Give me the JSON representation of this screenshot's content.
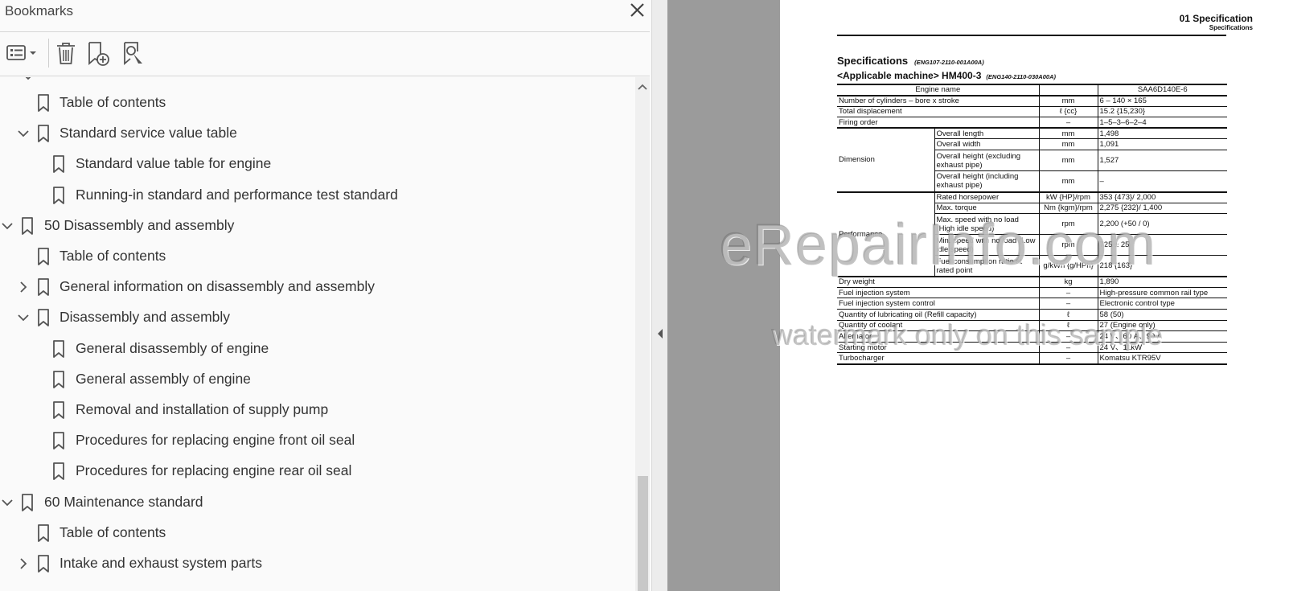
{
  "panel": {
    "title": "Bookmarks",
    "close_icon": "close-icon",
    "toolbar": [
      {
        "name": "options-menu-button",
        "icon": "list-options-icon"
      },
      {
        "name": "delete-bookmark-button",
        "icon": "trash-icon"
      },
      {
        "name": "new-bookmark-button",
        "icon": "bookmark-add-icon"
      },
      {
        "name": "find-bookmark-button",
        "icon": "bookmark-search-icon"
      }
    ]
  },
  "bookmarks": [
    {
      "level": 1,
      "chevron": "none",
      "label": "Table of contents"
    },
    {
      "level": 1,
      "chevron": "expanded",
      "label": "Standard service value table"
    },
    {
      "level": 2,
      "chevron": "none",
      "label": "Standard value table for engine"
    },
    {
      "level": 2,
      "chevron": "none",
      "label": "Running-in standard and performance test standard"
    },
    {
      "level": 0,
      "chevron": "expanded",
      "label": "50 Disassembly and assembly"
    },
    {
      "level": 1,
      "chevron": "none",
      "label": "Table of contents"
    },
    {
      "level": 1,
      "chevron": "collapsed",
      "label": "General information on disassembly and assembly"
    },
    {
      "level": 1,
      "chevron": "expanded",
      "label": "Disassembly and assembly"
    },
    {
      "level": 2,
      "chevron": "none",
      "label": "General disassembly of engine"
    },
    {
      "level": 2,
      "chevron": "none",
      "label": "General assembly of engine"
    },
    {
      "level": 2,
      "chevron": "none",
      "label": "Removal and installation of supply pump"
    },
    {
      "level": 2,
      "chevron": "none",
      "label": "Procedures for replacing engine front oil seal"
    },
    {
      "level": 2,
      "chevron": "none",
      "label": "Procedures for replacing engine rear oil seal"
    },
    {
      "level": 0,
      "chevron": "expanded",
      "label": "60 Maintenance standard"
    },
    {
      "level": 1,
      "chevron": "none",
      "label": "Table of contents"
    },
    {
      "level": 1,
      "chevron": "collapsed",
      "label": "Intake and exhaust system parts"
    }
  ],
  "document": {
    "header_title": "01 Specification",
    "header_subtitle": "Specifications",
    "section_title": "Specifications",
    "section_code": "(ENG107-2110-001A00A)",
    "applicable": "<Applicable machine> HM400-3",
    "applicable_code": "(ENG140-2110-030A00A)",
    "table_header": {
      "name": "Engine name",
      "value": "SAA6D140E-6"
    },
    "rows": [
      {
        "item": "Number of cylinders – bore x stroke",
        "unit": "mm",
        "value": "6 – 140 × 165"
      },
      {
        "item": "Total displacement",
        "unit": "ℓ {cc}",
        "value": "15.2 {15,230}"
      },
      {
        "item": "Firing order",
        "unit": "–",
        "value": "1–5–3–6–2–4"
      },
      {
        "group": "Dimension",
        "item": "Overall length",
        "unit": "mm",
        "value": "1,498"
      },
      {
        "group": "Dimension",
        "item": "Overall width",
        "unit": "mm",
        "value": "1,091"
      },
      {
        "group": "Dimension",
        "item": "Overall height (excluding exhaust pipe)",
        "unit": "mm",
        "value": "1,527"
      },
      {
        "group": "Dimension",
        "item": "Overall height (including exhaust pipe)",
        "unit": "mm",
        "value": "–"
      },
      {
        "group": "Performance",
        "item": "Rated horsepower",
        "unit": "kW {HP}/rpm",
        "value": "353 {473}/ 2,000"
      },
      {
        "group": "Performance",
        "item": "Max. torque",
        "unit": "Nm {kgm}/rpm",
        "value": "2,275 {232}/ 1,400"
      },
      {
        "group": "Performance",
        "item": "Max. speed with no load (High idle speed)",
        "unit": "rpm",
        "value": "2,200 (+50 / 0)"
      },
      {
        "group": "Performance",
        "item": "Min. speed with no load (Low idle speed)",
        "unit": "rpm",
        "value": "725 ± 25"
      },
      {
        "group": "Performance",
        "item": "Fuel consumption ratio at rated point",
        "unit": "g/kWh {g/HPh}",
        "value": "218 {163}"
      },
      {
        "item": "Dry weight",
        "unit": "kg",
        "value": "1,890"
      },
      {
        "item": "Fuel injection system",
        "unit": "–",
        "value": "High-pressure common rail type"
      },
      {
        "item": "Fuel injection system control",
        "unit": "–",
        "value": "Electronic control type"
      },
      {
        "item": "Quantity of lubricating oil (Refill capacity)",
        "unit": "ℓ",
        "value": "58 (50)"
      },
      {
        "item": "Quantity of coolant",
        "unit": "ℓ",
        "value": "27 (Engine only)"
      },
      {
        "item": "Alternator",
        "unit": "–",
        "value": "24 V、60 A、90 A"
      },
      {
        "item": "Starting motor",
        "unit": "–",
        "value": "24 V、11kW"
      },
      {
        "item": "Turbocharger",
        "unit": "–",
        "value": "Komatsu KTR95V"
      }
    ],
    "watermark_main": "eRepairInfo.com",
    "watermark_sub": "watermark only on this sample"
  },
  "colors": {
    "panel_bg": "#fafafa",
    "viewer_gray": "#9b9b9b",
    "text": "#333333"
  }
}
